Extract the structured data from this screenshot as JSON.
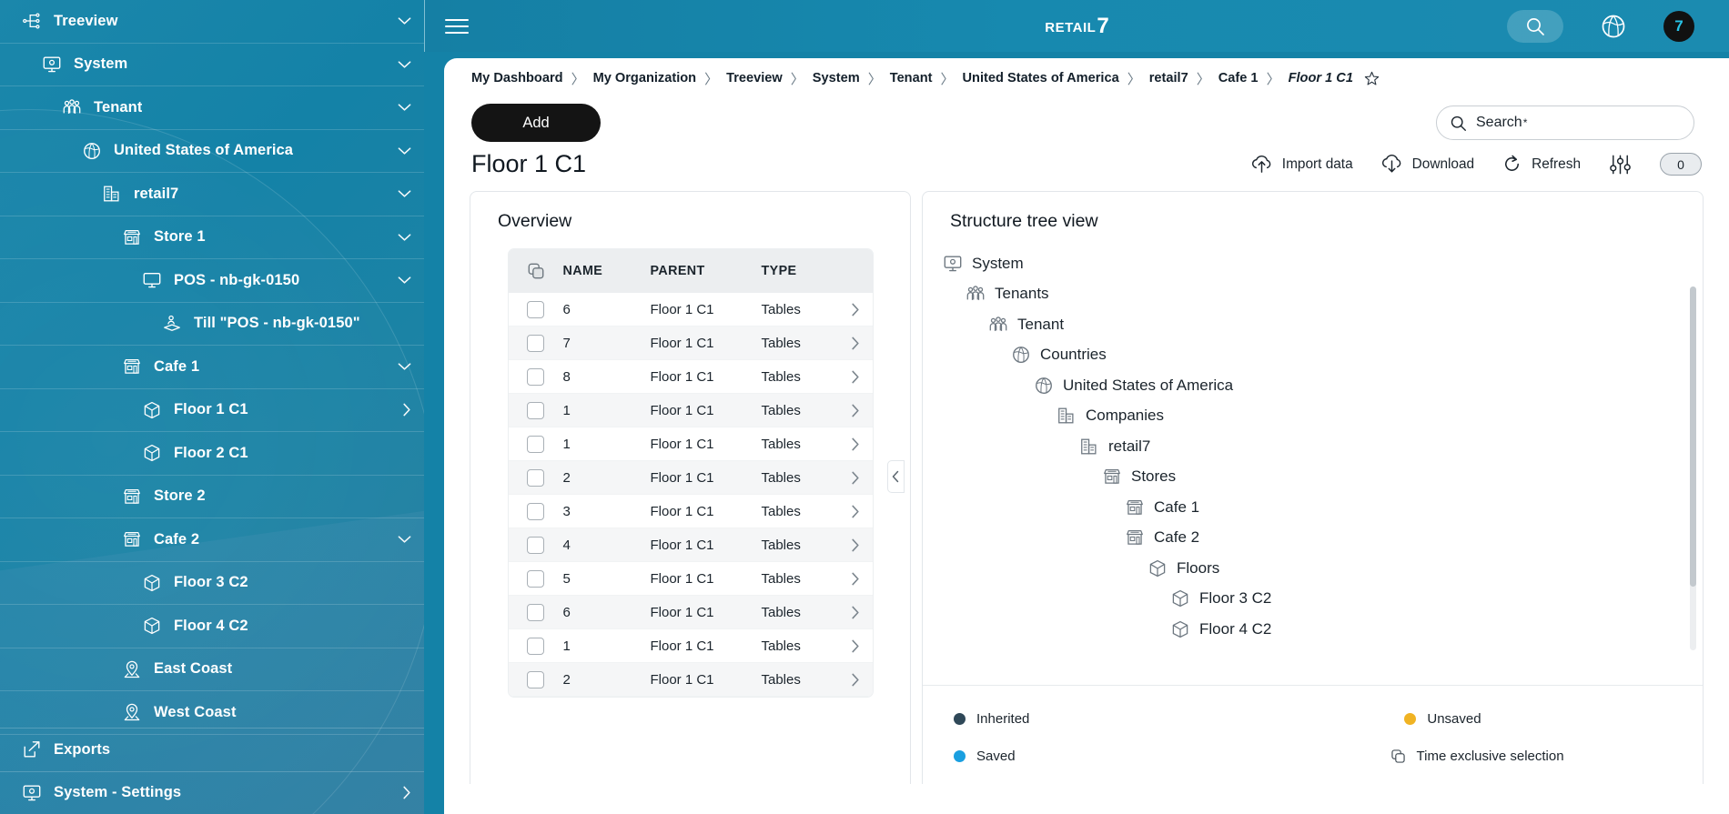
{
  "sidebar": {
    "items": [
      {
        "label": "Treeview",
        "icon": "treeview-icon",
        "indent": 0,
        "chevron": true
      },
      {
        "label": "System",
        "icon": "system-monitor-icon",
        "indent": 1,
        "chevron": true
      },
      {
        "label": "Tenant",
        "icon": "tenant-people-icon",
        "indent": 2,
        "chevron": true
      },
      {
        "label": "United States of America",
        "icon": "globe-icon",
        "indent": 3,
        "chevron": true
      },
      {
        "label": "retail7",
        "icon": "company-building-icon",
        "indent": 4,
        "chevron": true
      },
      {
        "label": "Store 1",
        "icon": "store-icon",
        "indent": 5,
        "chevron": true
      },
      {
        "label": "POS - nb-gk-0150",
        "icon": "monitor-icon",
        "indent": 6,
        "chevron": true
      },
      {
        "label": "Till \"POS - nb-gk-0150\"",
        "icon": "till-icon",
        "indent": 7,
        "chevron": false
      },
      {
        "label": "Cafe 1",
        "icon": "store-icon",
        "indent": 5,
        "chevron": true
      },
      {
        "label": "Floor 1 C1",
        "icon": "floor-cube-icon",
        "indent": 6,
        "chevron": true
      },
      {
        "label": "Floor 2 C1",
        "icon": "floor-cube-icon",
        "indent": 6,
        "chevron": false
      },
      {
        "label": "Store 2",
        "icon": "store-icon",
        "indent": 5,
        "chevron": false
      },
      {
        "label": "Cafe 2",
        "icon": "store-icon",
        "indent": 5,
        "chevron": true
      },
      {
        "label": "Floor 3 C2",
        "icon": "floor-cube-icon",
        "indent": 6,
        "chevron": false
      },
      {
        "label": "Floor 4 C2",
        "icon": "floor-cube-icon",
        "indent": 6,
        "chevron": false
      },
      {
        "label": "East Coast",
        "icon": "location-pin-icon",
        "indent": 5,
        "chevron": false
      },
      {
        "label": "West Coast",
        "icon": "location-pin-icon",
        "indent": 5,
        "chevron": false
      }
    ],
    "bottom": [
      {
        "label": "Exports",
        "icon": "export-icon",
        "chevron": false
      },
      {
        "label": "System - Settings",
        "icon": "system-monitor-icon",
        "chevron": true
      }
    ],
    "background_color": "#1482a7"
  },
  "topbar": {
    "menu_icon": "hamburger-menu-icon",
    "brand": "Retail",
    "brand_accent": "7",
    "search_icon": "search-icon",
    "language_icon": "globe-language-icon",
    "avatar_label": "7"
  },
  "breadcrumb": {
    "items": [
      "My Dashboard",
      "My Organization",
      "Treeview",
      "System",
      "Tenant",
      "United States of America",
      "retail7",
      "Cafe 1"
    ],
    "current": "Floor 1 C1",
    "separator": "〉",
    "favorite_icon": "star-outline-icon"
  },
  "toolbar": {
    "add_label": "Add",
    "search_placeholder": "Search",
    "search_required_marker": "*",
    "search_icon": "search-icon"
  },
  "page": {
    "title": "Floor 1 C1",
    "actions": [
      {
        "label": "Import data",
        "icon": "cloud-upload-icon"
      },
      {
        "label": "Download",
        "icon": "cloud-download-icon"
      },
      {
        "label": "Refresh",
        "icon": "refresh-icon"
      }
    ],
    "filter_icon": "filter-sliders-icon",
    "counter": "0"
  },
  "overview": {
    "title": "Overview",
    "columns": [
      "",
      "NAME",
      "PARENT",
      "TYPE",
      ""
    ],
    "select_all_icon": "copy-select-icon",
    "rows": [
      {
        "name": "6",
        "parent": "Floor 1 C1",
        "type": "Tables"
      },
      {
        "name": "7",
        "parent": "Floor 1 C1",
        "type": "Tables"
      },
      {
        "name": "8",
        "parent": "Floor 1 C1",
        "type": "Tables"
      },
      {
        "name": "1",
        "parent": "Floor 1 C1",
        "type": "Tables"
      },
      {
        "name": "1",
        "parent": "Floor 1 C1",
        "type": "Tables"
      },
      {
        "name": "2",
        "parent": "Floor 1 C1",
        "type": "Tables"
      },
      {
        "name": "3",
        "parent": "Floor 1 C1",
        "type": "Tables"
      },
      {
        "name": "4",
        "parent": "Floor 1 C1",
        "type": "Tables"
      },
      {
        "name": "5",
        "parent": "Floor 1 C1",
        "type": "Tables"
      },
      {
        "name": "6",
        "parent": "Floor 1 C1",
        "type": "Tables"
      },
      {
        "name": "1",
        "parent": "Floor 1 C1",
        "type": "Tables"
      },
      {
        "name": "2",
        "parent": "Floor 1 C1",
        "type": "Tables"
      }
    ]
  },
  "structure_tree": {
    "title": "Structure tree view",
    "nodes": [
      {
        "label": "System",
        "icon": "system-monitor-icon",
        "depth": 0
      },
      {
        "label": "Tenants",
        "icon": "tenant-people-icon",
        "depth": 1
      },
      {
        "label": "Tenant",
        "icon": "tenant-people-icon",
        "depth": 2
      },
      {
        "label": "Countries",
        "icon": "globe-icon",
        "depth": 3
      },
      {
        "label": "United States of America",
        "icon": "globe-icon",
        "depth": 4
      },
      {
        "label": "Companies",
        "icon": "company-building-icon",
        "depth": 5
      },
      {
        "label": "retail7",
        "icon": "company-building-icon",
        "depth": 6
      },
      {
        "label": "Stores",
        "icon": "store-icon",
        "depth": 7
      },
      {
        "label": "Cafe 1",
        "icon": "store-icon",
        "depth": 8
      },
      {
        "label": "Cafe 2",
        "icon": "store-icon",
        "depth": 8
      },
      {
        "label": "Floors",
        "icon": "floor-cube-icon",
        "depth": 9
      },
      {
        "label": "Floor 3 C2",
        "icon": "floor-cube-icon",
        "depth": 10
      },
      {
        "label": "Floor 4 C2",
        "icon": "floor-cube-icon",
        "depth": 10
      }
    ],
    "legend": [
      {
        "label": "Inherited",
        "color": "#2f4858",
        "icon": "dot"
      },
      {
        "label": "Unsaved",
        "color": "#f0b323",
        "icon": "dot"
      },
      {
        "label": "Saved",
        "color": "#1a9fe0",
        "icon": "dot"
      },
      {
        "label": "Time exclusive selection",
        "color": "#1b242c",
        "icon": "copy-select-icon"
      }
    ]
  }
}
